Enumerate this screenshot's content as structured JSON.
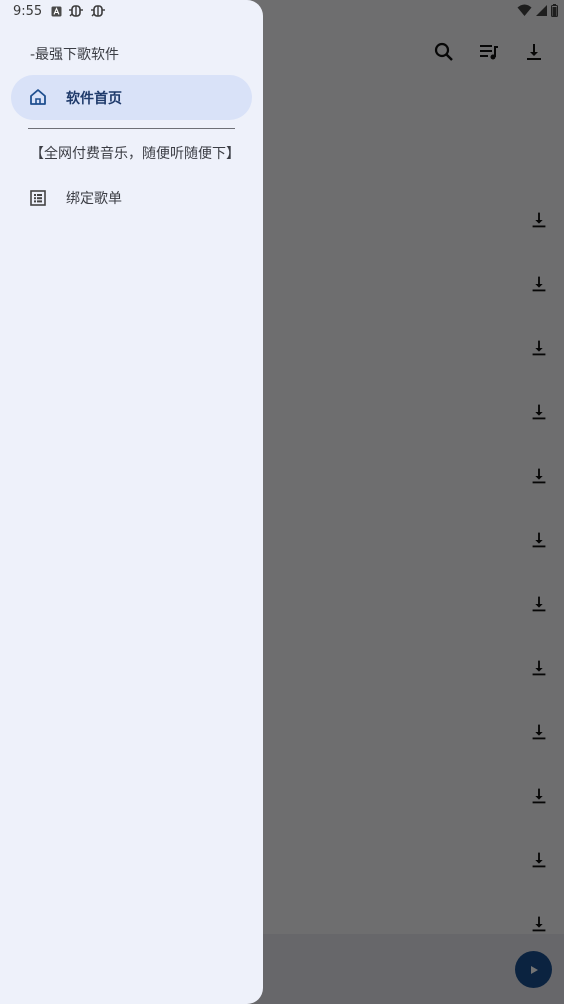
{
  "status_bar": {
    "time": "9:55",
    "left_icons": [
      "a-badge-icon",
      "bug-icon",
      "bug-icon"
    ],
    "right_icons": [
      "wifi-icon",
      "signal-icon",
      "battery-icon"
    ]
  },
  "drawer": {
    "header": "-最强下歌软件",
    "items": [
      {
        "label": "软件首页",
        "icon": "home-icon",
        "active": true
      },
      {
        "label": "绑定歌单",
        "icon": "list-icon",
        "active": false
      }
    ],
    "section_label": "【全网付费音乐，随便听随便下】"
  },
  "app": {
    "toolbar_icons": [
      "search-icon",
      "playlist-icon",
      "download-icon"
    ],
    "row_download_icons_count": 12
  },
  "colors": {
    "drawer_bg": "#eef1fa",
    "active_item_bg": "#d9e2f8",
    "accent": "#1a4f8e",
    "scrim": "rgba(0,0,0,0.55)"
  }
}
